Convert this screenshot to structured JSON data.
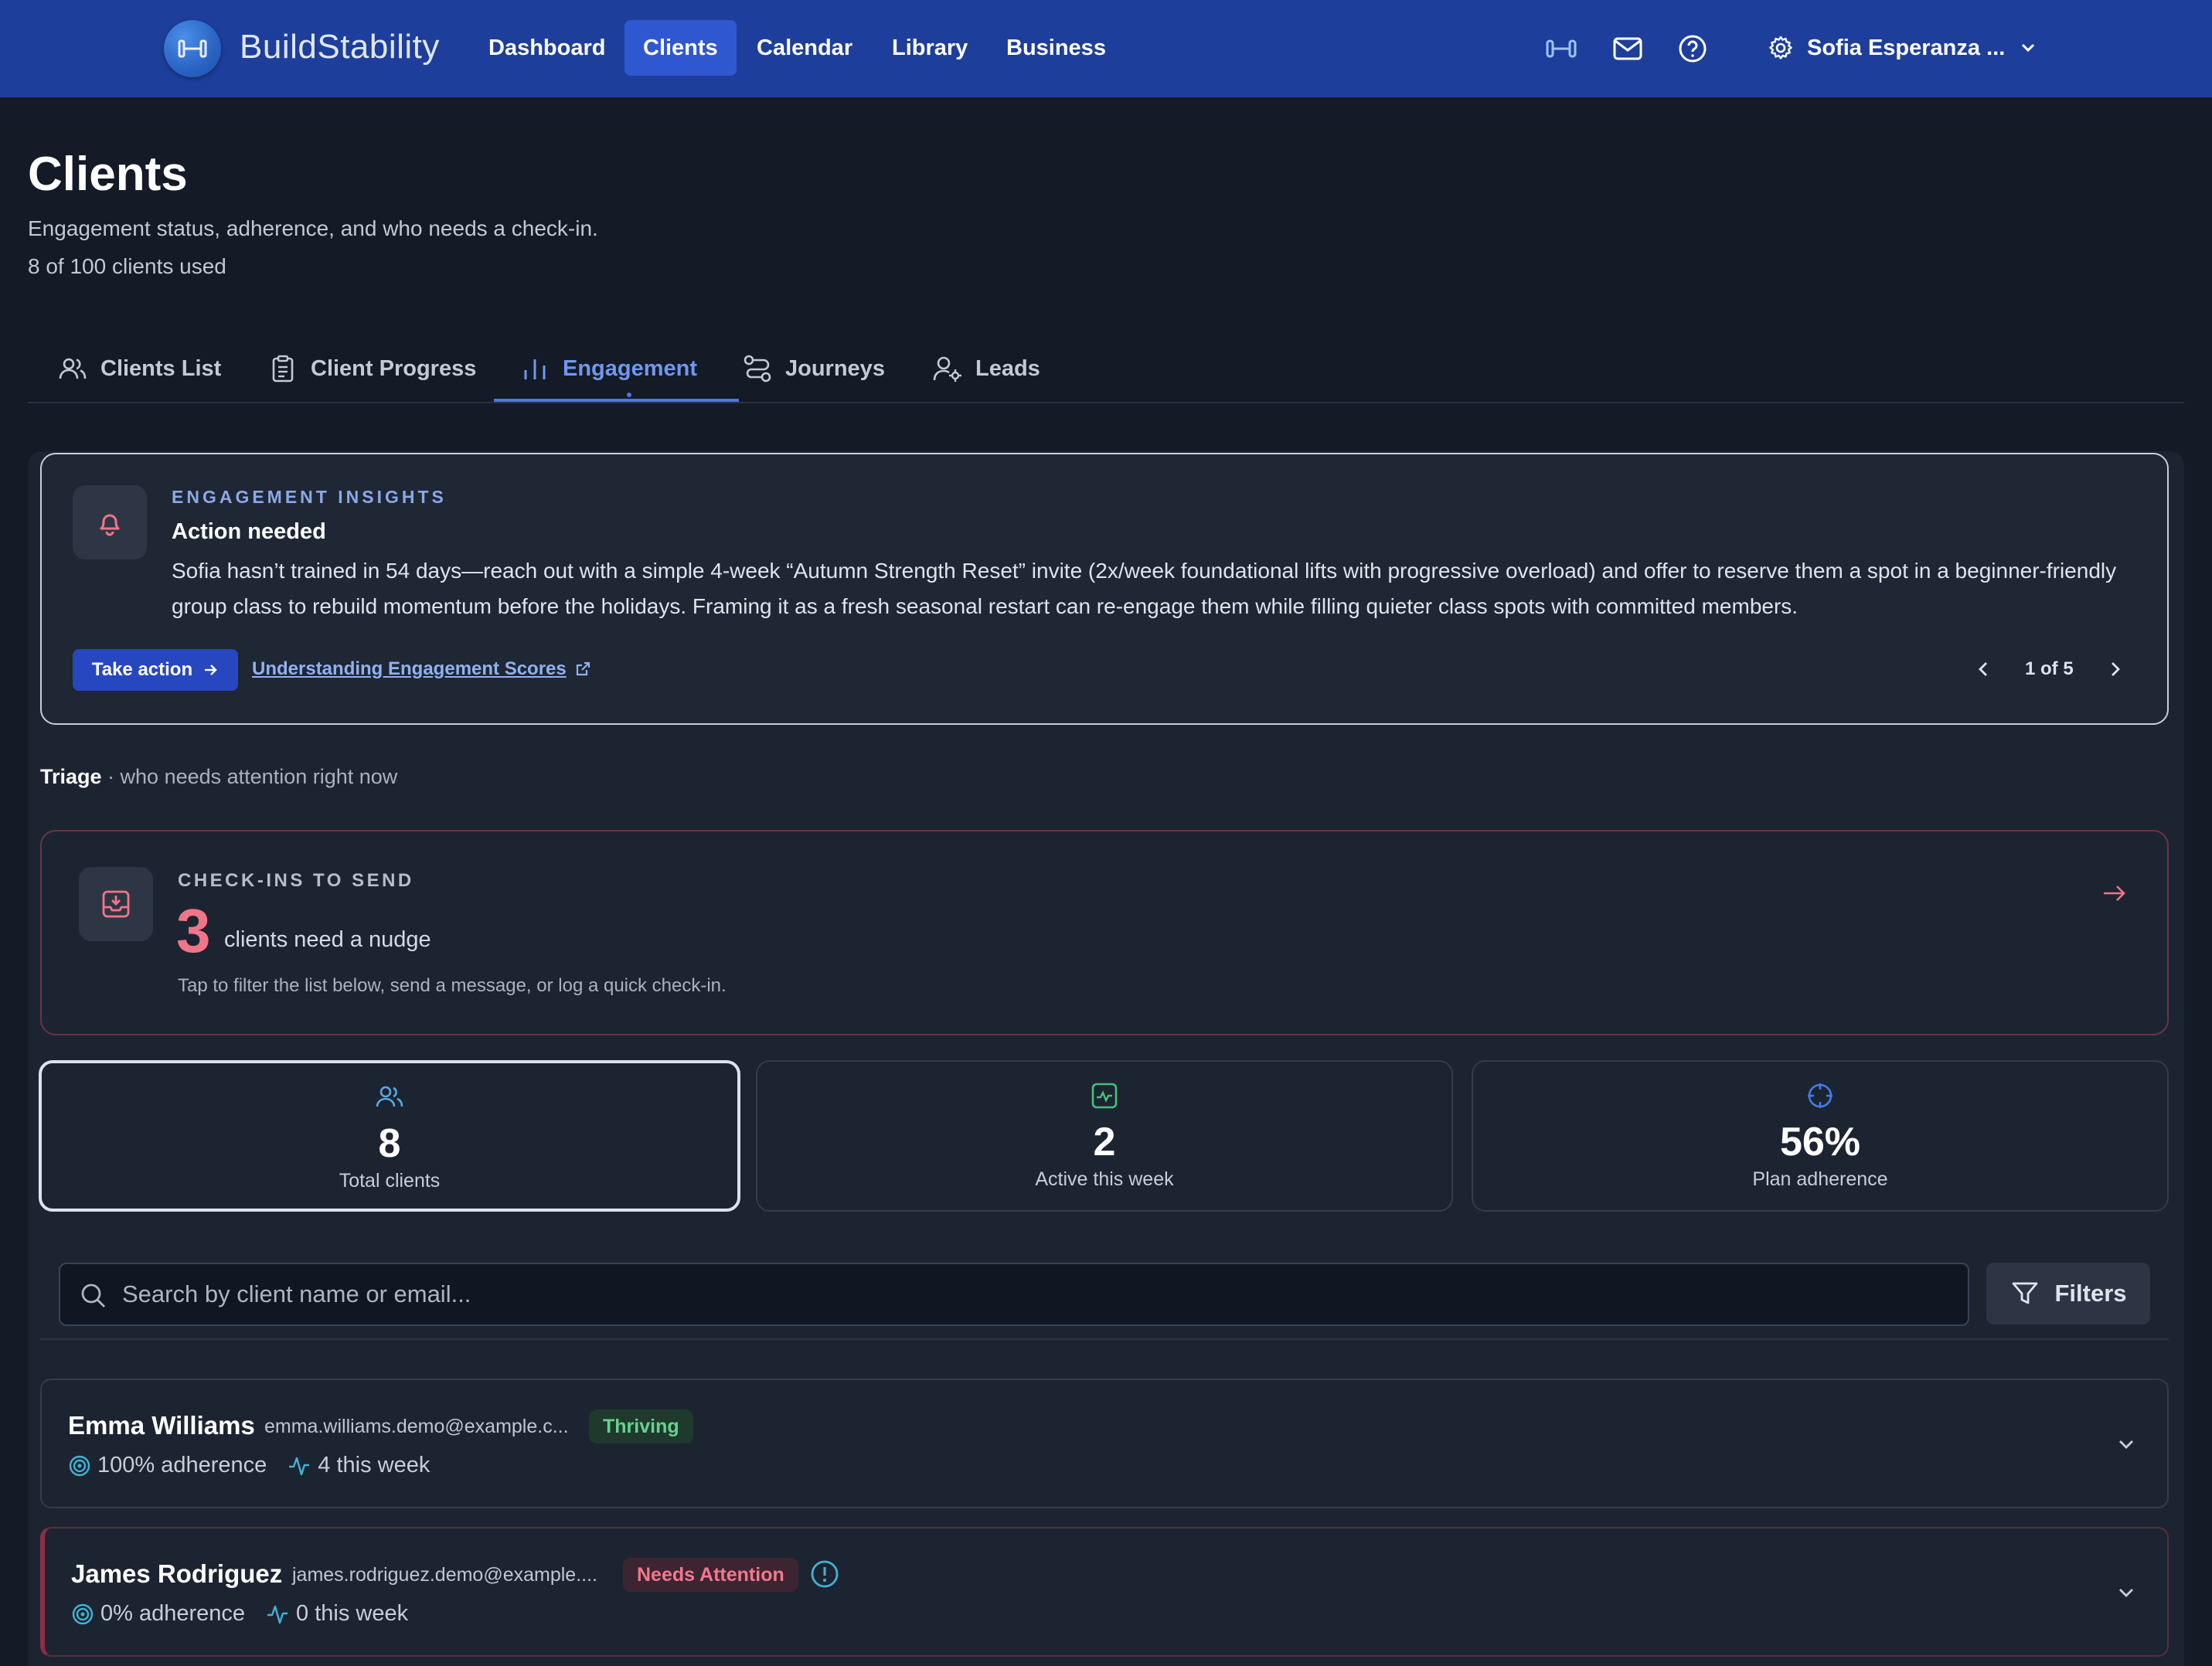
{
  "brand": {
    "name": "BuildStability"
  },
  "nav": {
    "items": [
      {
        "label": "Dashboard",
        "active": false
      },
      {
        "label": "Clients",
        "active": true
      },
      {
        "label": "Calendar",
        "active": false
      },
      {
        "label": "Library",
        "active": false
      },
      {
        "label": "Business",
        "active": false
      }
    ],
    "icons": [
      "dumbbell-icon",
      "mail-icon",
      "help-circle-icon",
      "gear-icon"
    ],
    "user_name": "Sofia Esperanza ..."
  },
  "header": {
    "title": "Clients",
    "subtitle": "Engagement status, adherence, and who needs a check-in.",
    "usage": "8 of 100 clients used"
  },
  "tabs": [
    {
      "label": "Clients List",
      "icon": "users-icon",
      "active": false
    },
    {
      "label": "Client Progress",
      "icon": "clipboard-icon",
      "active": false
    },
    {
      "label": "Engagement",
      "icon": "bar-chart-icon",
      "active": true
    },
    {
      "label": "Journeys",
      "icon": "route-icon",
      "active": false
    },
    {
      "label": "Leads",
      "icon": "user-cog-icon",
      "active": false
    }
  ],
  "insight": {
    "kicker": "ENGAGEMENT INSIGHTS",
    "title": "Action needed",
    "body": "Sofia hasn’t trained in 54 days—reach out with a simple 4-week “Autumn Strength Reset” invite (2x/week foundational lifts with progressive overload) and offer to reserve them a spot in a beginner-friendly group class to rebuild momentum before the holidays. Framing it as a fresh seasonal restart can re-engage them while filling quieter class spots with committed members.",
    "action_label": "Take action",
    "link_label": "Understanding Engagement Scores",
    "pager": "1 of 5"
  },
  "triage": {
    "label": "Triage",
    "sub": " · who needs attention right now"
  },
  "checkins": {
    "kicker": "CHECK-INS TO SEND",
    "count": "3",
    "label": "clients need a nudge",
    "help": "Tap to filter the list below, send a message, or log a quick check-in."
  },
  "stats": [
    {
      "value": "8",
      "label": "Total clients",
      "icon": "users-icon",
      "color": "#5aa8e0"
    },
    {
      "value": "2",
      "label": "Active this week",
      "icon": "activity-square-icon",
      "color": "#4bbf7a"
    },
    {
      "value": "56%",
      "label": "Plan adherence",
      "icon": "crosshair-icon",
      "color": "#3f7ee8"
    }
  ],
  "search": {
    "placeholder": "Search by client name or email...",
    "value": ""
  },
  "filters_label": "Filters",
  "clients": [
    {
      "name": "Emma Williams",
      "email": "emma.williams.demo@example.c...",
      "status": "Thriving",
      "adherence": "100% adherence",
      "sessions": "4 this week"
    },
    {
      "name": "James Rodriguez",
      "email": "james.rodriguez.demo@example....",
      "status": "Needs Attention",
      "adherence": "0% adherence",
      "sessions": "0 this week"
    }
  ],
  "colors": {
    "topbar": "#1e3e9c",
    "accent": "#2f58d0",
    "alert": "#f07588",
    "good": "#64d38f"
  }
}
